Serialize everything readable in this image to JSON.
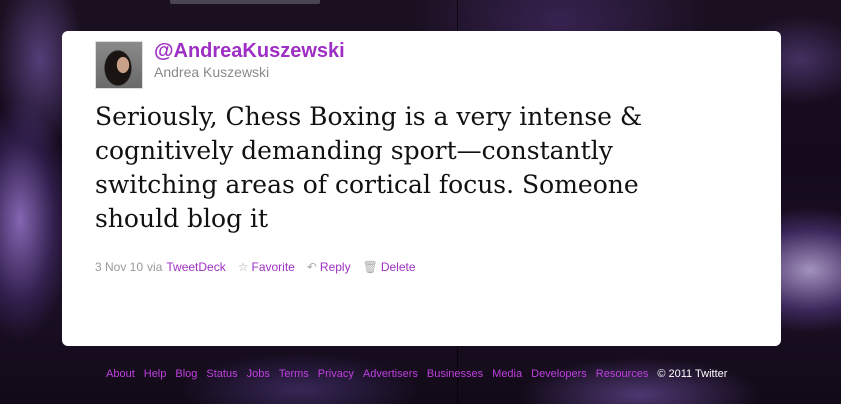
{
  "tweet": {
    "handle": "@AndreaKuszewski",
    "name": "Andrea Kuszewski",
    "text": "Seriously, Chess Boxing is a very intense & cognitively demanding sport—constantly switching areas of cortical focus. Someone should blog it",
    "date": "3 Nov 10",
    "via": "via",
    "source": "TweetDeck",
    "actions": {
      "favorite": "Favorite",
      "reply": "Reply",
      "delete": "Delete"
    }
  },
  "footer": {
    "links": [
      "About",
      "Help",
      "Blog",
      "Status",
      "Jobs",
      "Terms",
      "Privacy",
      "Advertisers",
      "Businesses",
      "Media",
      "Developers",
      "Resources"
    ],
    "copyright": "© 2011 Twitter"
  },
  "colors": {
    "accent": "#9e2fc4",
    "footer_link": "#c040e0",
    "card": "#ffffff"
  },
  "icons": {
    "favorite": "star-icon",
    "reply": "reply-arrow-icon",
    "delete": "trash-icon"
  }
}
